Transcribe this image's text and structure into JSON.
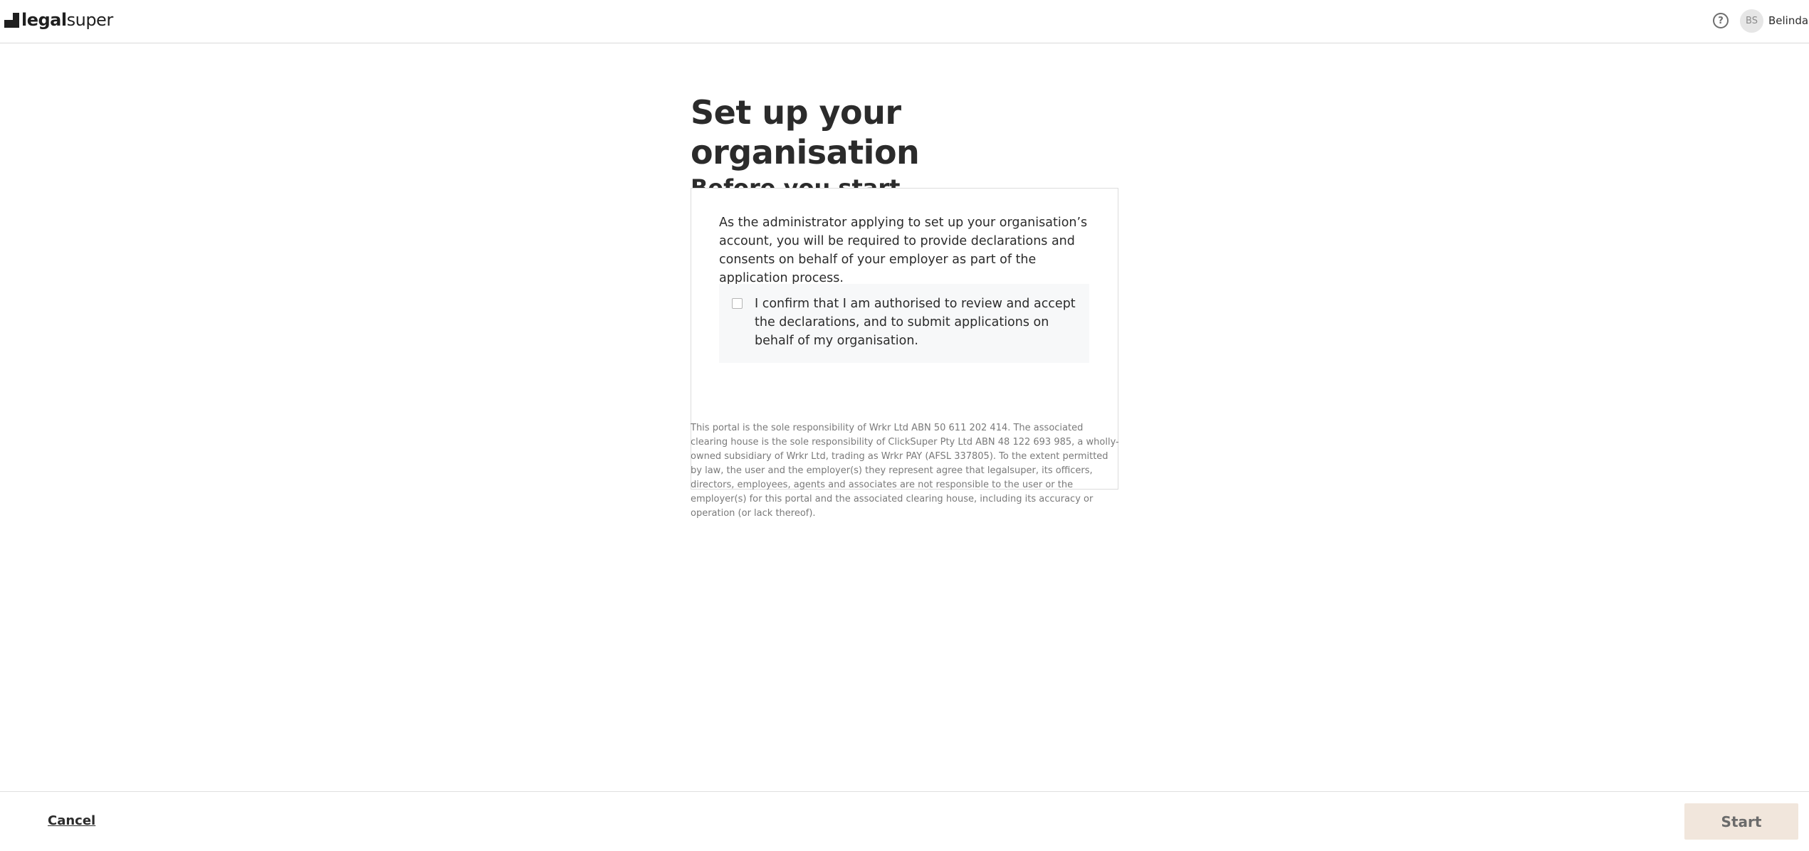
{
  "header": {
    "logo_prefix": "legal",
    "logo_suffix": "super",
    "help_icon": "help-circle-icon",
    "avatar_initials": "BS",
    "user_name": "Belinda"
  },
  "main": {
    "title": "Set up your organisation",
    "subtitle": "Before you start",
    "card": {
      "intro": "As the administrator applying to set up your organisation’s account, you will be required to provide declarations and consents on behalf of your employer as part of the application process.",
      "confirm_label": "I confirm that I am authorised to review and accept the declarations, and to submit applications on behalf of my organisation.",
      "confirm_checked": false
    },
    "disclaimer": "This portal is the sole responsibility of Wrkr Ltd ABN 50 611 202 414. The associated clearing house is the sole responsibility of ClickSuper Pty Ltd ABN 48 122 693 985, a wholly-owned subsidiary of Wrkr Ltd, trading as Wrkr PAY (AFSL 337805). To the extent permitted by law, the user and the employer(s) they represent agree that legalsuper, its officers, directors, employees, agents and associates are not responsible to the user or the employer(s) for this portal and the associated clearing house, including its accuracy or operation (or lack thereof)."
  },
  "footer": {
    "cancel_label": "Cancel",
    "start_label": "Start"
  },
  "colors": {
    "start_button_bg": "#f1e6dc",
    "text": "#2b2b2b",
    "disclaimer_text": "#7a7a7a"
  }
}
